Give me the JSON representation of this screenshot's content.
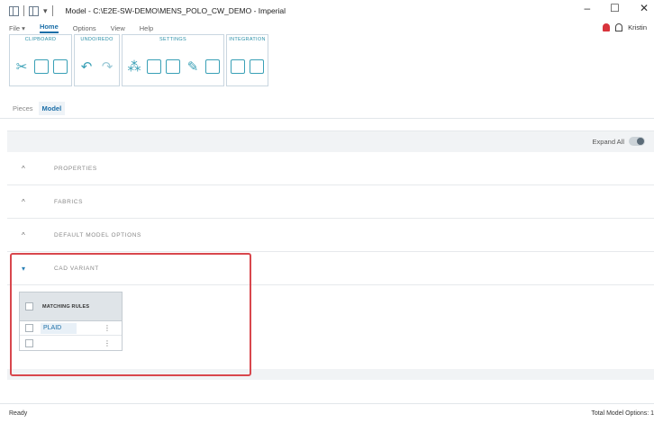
{
  "window": {
    "title": "Model - C:\\E2E-SW-DEMO\\MENS_POLO_CW_DEMO - Imperial"
  },
  "menu": {
    "items": [
      "File ▾",
      "Home",
      "Options",
      "View",
      "Help"
    ],
    "active": "Home"
  },
  "user": {
    "name": "Kristin"
  },
  "ribbon": {
    "groups": [
      {
        "label": "CLIPBOARD",
        "icons": [
          "cut-icon",
          "copy-icon",
          "paste-icon"
        ]
      },
      {
        "label": "UNDO/REDO",
        "icons": [
          "undo-icon",
          "redo-icon"
        ]
      },
      {
        "label": "SETTINGS",
        "icons": [
          "size-settings-icon",
          "fabric-settings-icon",
          "layout-settings-icon",
          "rules-settings-icon",
          "grid-settings-icon"
        ]
      },
      {
        "label": "INTEGRATION",
        "icons": [
          "import-icon",
          "export-icon"
        ]
      }
    ]
  },
  "subtabs": [
    "Pieces",
    "Model"
  ],
  "subtab_active": "Model",
  "toolbar": {
    "expand_label": "Expand All"
  },
  "sections": [
    {
      "title": "PROPERTIES",
      "expanded": false
    },
    {
      "title": "FABRICS",
      "expanded": false
    },
    {
      "title": "DEFAULT MODEL OPTIONS",
      "expanded": false
    },
    {
      "title": "CAD VARIANT",
      "expanded": true
    }
  ],
  "grid": {
    "header": "MATCHING RULES",
    "rows": [
      {
        "value": "PLAID"
      },
      {
        "value": ""
      }
    ]
  },
  "status": {
    "left": "Ready",
    "right": "Total Model Options: 1"
  },
  "colors": {
    "accent": "#1c6fa8",
    "highlight": "#d8474d",
    "icon": "#39a0b6"
  }
}
